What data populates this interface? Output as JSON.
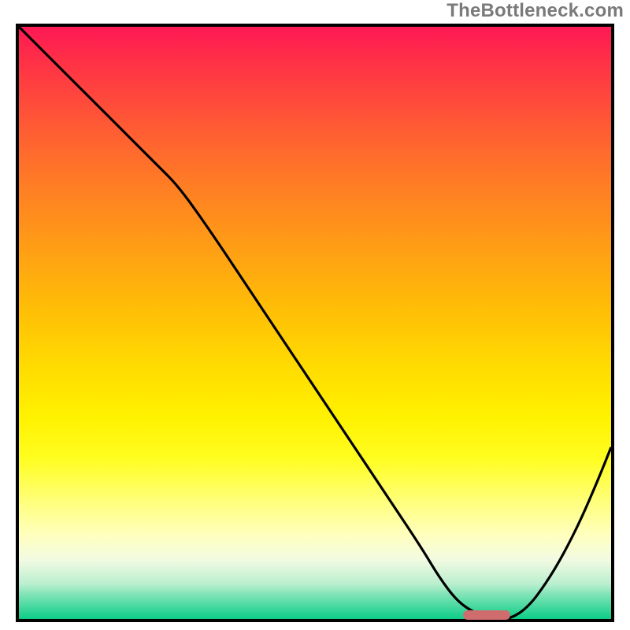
{
  "watermark": "TheBottleneck.com",
  "chart_data": {
    "type": "line",
    "title": "",
    "xlabel": "",
    "ylabel": "",
    "xlim": [
      0,
      100
    ],
    "ylim": [
      0,
      100
    ],
    "grid": false,
    "legend": false,
    "background_gradient": {
      "kind": "vertical",
      "top_color": "#fe1854",
      "mid_color": "#ffdd00",
      "bottom_color": "#0dcd87"
    },
    "series": [
      {
        "name": "curve",
        "x": [
          0,
          6,
          12,
          18,
          23,
          27,
          32,
          38,
          44,
          50,
          56,
          62,
          68,
          71,
          74,
          77,
          80,
          83,
          86,
          89,
          92,
          95,
          98,
          100
        ],
        "y": [
          100,
          94,
          88,
          82,
          77,
          73,
          66,
          57,
          48,
          39,
          30,
          21,
          12,
          7,
          3,
          1,
          0,
          0,
          2,
          6,
          11,
          17,
          24,
          29
        ]
      }
    ],
    "marker": {
      "name": "highlight-bar",
      "x_start": 75,
      "x_end": 83,
      "y": 0.7,
      "color": "#cf6d6e"
    }
  }
}
